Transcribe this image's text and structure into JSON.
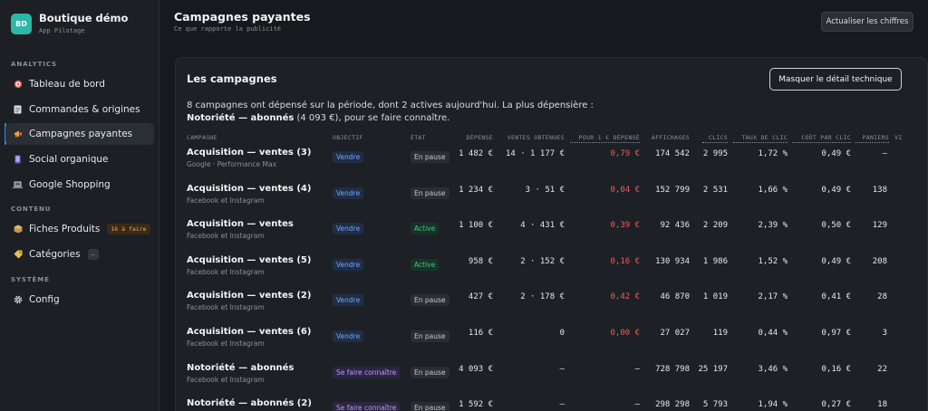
{
  "app": {
    "logo_initials": "BD",
    "name": "Boutique démo",
    "subtitle": "App Pilotage"
  },
  "sidebar": {
    "sections": {
      "analytics": "ANALYTICS",
      "contenu": "CONTENU",
      "systeme": "SYSTÈME"
    },
    "items": [
      {
        "label": "Tableau de bord",
        "icon": "target-icon"
      },
      {
        "label": "Commandes & origines",
        "icon": "document-icon"
      },
      {
        "label": "Campagnes payantes",
        "icon": "megaphone-icon",
        "active": true
      },
      {
        "label": "Social organique",
        "icon": "phone-icon"
      },
      {
        "label": "Google Shopping",
        "icon": "laptop-icon"
      },
      {
        "label": "Fiches Produits",
        "icon": "package-icon",
        "badge": "16 à faire"
      },
      {
        "label": "Catégories",
        "icon": "label-icon",
        "badge": "—"
      },
      {
        "label": "Config",
        "icon": "gear-icon"
      }
    ]
  },
  "header": {
    "title": "Campagnes payantes",
    "subtitle": "Ce que rapporte la publicité",
    "refresh_label": "Actualiser les chiffres"
  },
  "card": {
    "title": "Les campagnes",
    "toggle_label": "Masquer le détail technique",
    "summary_line1": "8 campagnes ont dépensé sur la période, dont 2 actives aujourd'hui. La plus dépensière :",
    "summary_bold": "Notoriété — abonnés",
    "summary_rest": " (4 093 €), pour se faire connaître."
  },
  "table": {
    "headers": {
      "campagne": "CAMPAGNE",
      "objectif": "OBJECTIF",
      "etat": "ÉTAT",
      "depense": "DÉPENSE",
      "ventes": "VENTES OBTENUES",
      "pour1": "POUR 1 € DÉPENSÉ",
      "affichages": "AFFICHAGES",
      "clics": "CLICS",
      "taux": "TAUX DE CLIC",
      "cpc": "COÛT PAR CLIC",
      "paniers": "PANIERS",
      "vi": "VI"
    },
    "rows": [
      {
        "name": "Acquisition — ventes (3)",
        "source": "Google · Performance Max",
        "objective": "Vendre",
        "objective_kind": "blue",
        "state": "En pause",
        "state_kind": "pause",
        "spend": "1 482 €",
        "sales": "14 · 1 177 €",
        "per_euro": "0,79 €",
        "impressions": "174 542",
        "clicks": "2 995",
        "ctr": "1,72 %",
        "cpc": "0,49 €",
        "carts": "—"
      },
      {
        "name": "Acquisition — ventes (4)",
        "source": "Facebook et Instagram",
        "objective": "Vendre",
        "objective_kind": "blue",
        "state": "En pause",
        "state_kind": "pause",
        "spend": "1 234 €",
        "sales": "3 · 51 €",
        "per_euro": "0,04 €",
        "impressions": "152 799",
        "clicks": "2 531",
        "ctr": "1,66 %",
        "cpc": "0,49 €",
        "carts": "138"
      },
      {
        "name": "Acquisition — ventes",
        "source": "Facebook et Instagram",
        "objective": "Vendre",
        "objective_kind": "blue",
        "state": "Active",
        "state_kind": "active",
        "spend": "1 100 €",
        "sales": "4 · 431 €",
        "per_euro": "0,39 €",
        "impressions": "92 436",
        "clicks": "2 209",
        "ctr": "2,39 %",
        "cpc": "0,50 €",
        "carts": "129"
      },
      {
        "name": "Acquisition — ventes (5)",
        "source": "Facebook et Instagram",
        "objective": "Vendre",
        "objective_kind": "blue",
        "state": "Active",
        "state_kind": "active",
        "spend": "958 €",
        "sales": "2 · 152 €",
        "per_euro": "0,16 €",
        "impressions": "130 934",
        "clicks": "1 986",
        "ctr": "1,52 %",
        "cpc": "0,49 €",
        "carts": "208"
      },
      {
        "name": "Acquisition — ventes (2)",
        "source": "Facebook et Instagram",
        "objective": "Vendre",
        "objective_kind": "blue",
        "state": "En pause",
        "state_kind": "pause",
        "spend": "427 €",
        "sales": "2 · 178 €",
        "per_euro": "0,42 €",
        "impressions": "46 870",
        "clicks": "1 019",
        "ctr": "2,17 %",
        "cpc": "0,41 €",
        "carts": "28"
      },
      {
        "name": "Acquisition — ventes (6)",
        "source": "Facebook et Instagram",
        "objective": "Vendre",
        "objective_kind": "blue",
        "state": "En pause",
        "state_kind": "pause",
        "spend": "116 €",
        "sales": "0",
        "per_euro": "0,00 €",
        "impressions": "27 027",
        "clicks": "119",
        "ctr": "0,44 %",
        "cpc": "0,97 €",
        "carts": "3"
      },
      {
        "name": "Notoriété — abonnés",
        "source": "Facebook et Instagram",
        "objective": "Se faire connaître",
        "objective_kind": "purple",
        "state": "En pause",
        "state_kind": "pause",
        "spend": "4 093 €",
        "sales": "—",
        "per_euro": "—",
        "impressions": "728 798",
        "clicks": "25 197",
        "ctr": "3,46 %",
        "cpc": "0,16 €",
        "carts": "22"
      },
      {
        "name": "Notoriété — abonnés (2)",
        "source": "Facebook et Instagram",
        "objective": "Se faire connaître",
        "objective_kind": "purple",
        "state": "En pause",
        "state_kind": "pause",
        "spend": "1 592 €",
        "sales": "—",
        "per_euro": "—",
        "impressions": "298 298",
        "clicks": "5 793",
        "ctr": "1,94 %",
        "cpc": "0,27 €",
        "carts": "18"
      }
    ]
  },
  "colors": {
    "accent": "#3a86ff",
    "danger": "#ef5b5b",
    "success": "#4cc38a",
    "brand": "#2bb8a8"
  }
}
